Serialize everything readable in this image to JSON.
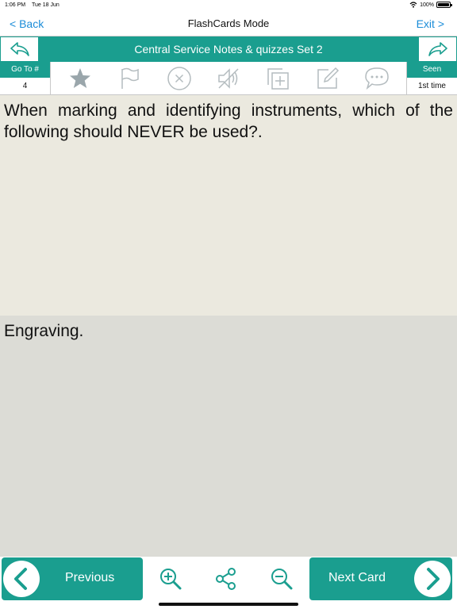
{
  "status": {
    "time": "1:06 PM",
    "date": "Tue 18 Jun",
    "battery": "100%",
    "battery_level": 1.0
  },
  "nav": {
    "back_label": "< Back",
    "title": "FlashCards Mode",
    "exit_label": "Exit >"
  },
  "set": {
    "title": "Central Service Notes & quizzes Set 2"
  },
  "goto": {
    "label": "Go To #",
    "value": "4"
  },
  "seen": {
    "label": "Seen",
    "value": "1st time"
  },
  "toolbar_icons": [
    "star-icon",
    "flag-icon",
    "close-circle-icon",
    "mute-icon",
    "copy-add-icon",
    "edit-icon",
    "comment-icon"
  ],
  "card": {
    "question": "When marking and identifying instruments, which of the following should NEVER be used?.",
    "answer": "Engraving."
  },
  "bottom": {
    "previous_label": "Previous",
    "next_label": "Next Card"
  },
  "colors": {
    "teal": "#1a9e8f",
    "link": "#1a8cd8",
    "question_bg": "#ebe9df",
    "answer_bg": "#dcdcd6",
    "icon_gray": "#b4bcbf"
  }
}
